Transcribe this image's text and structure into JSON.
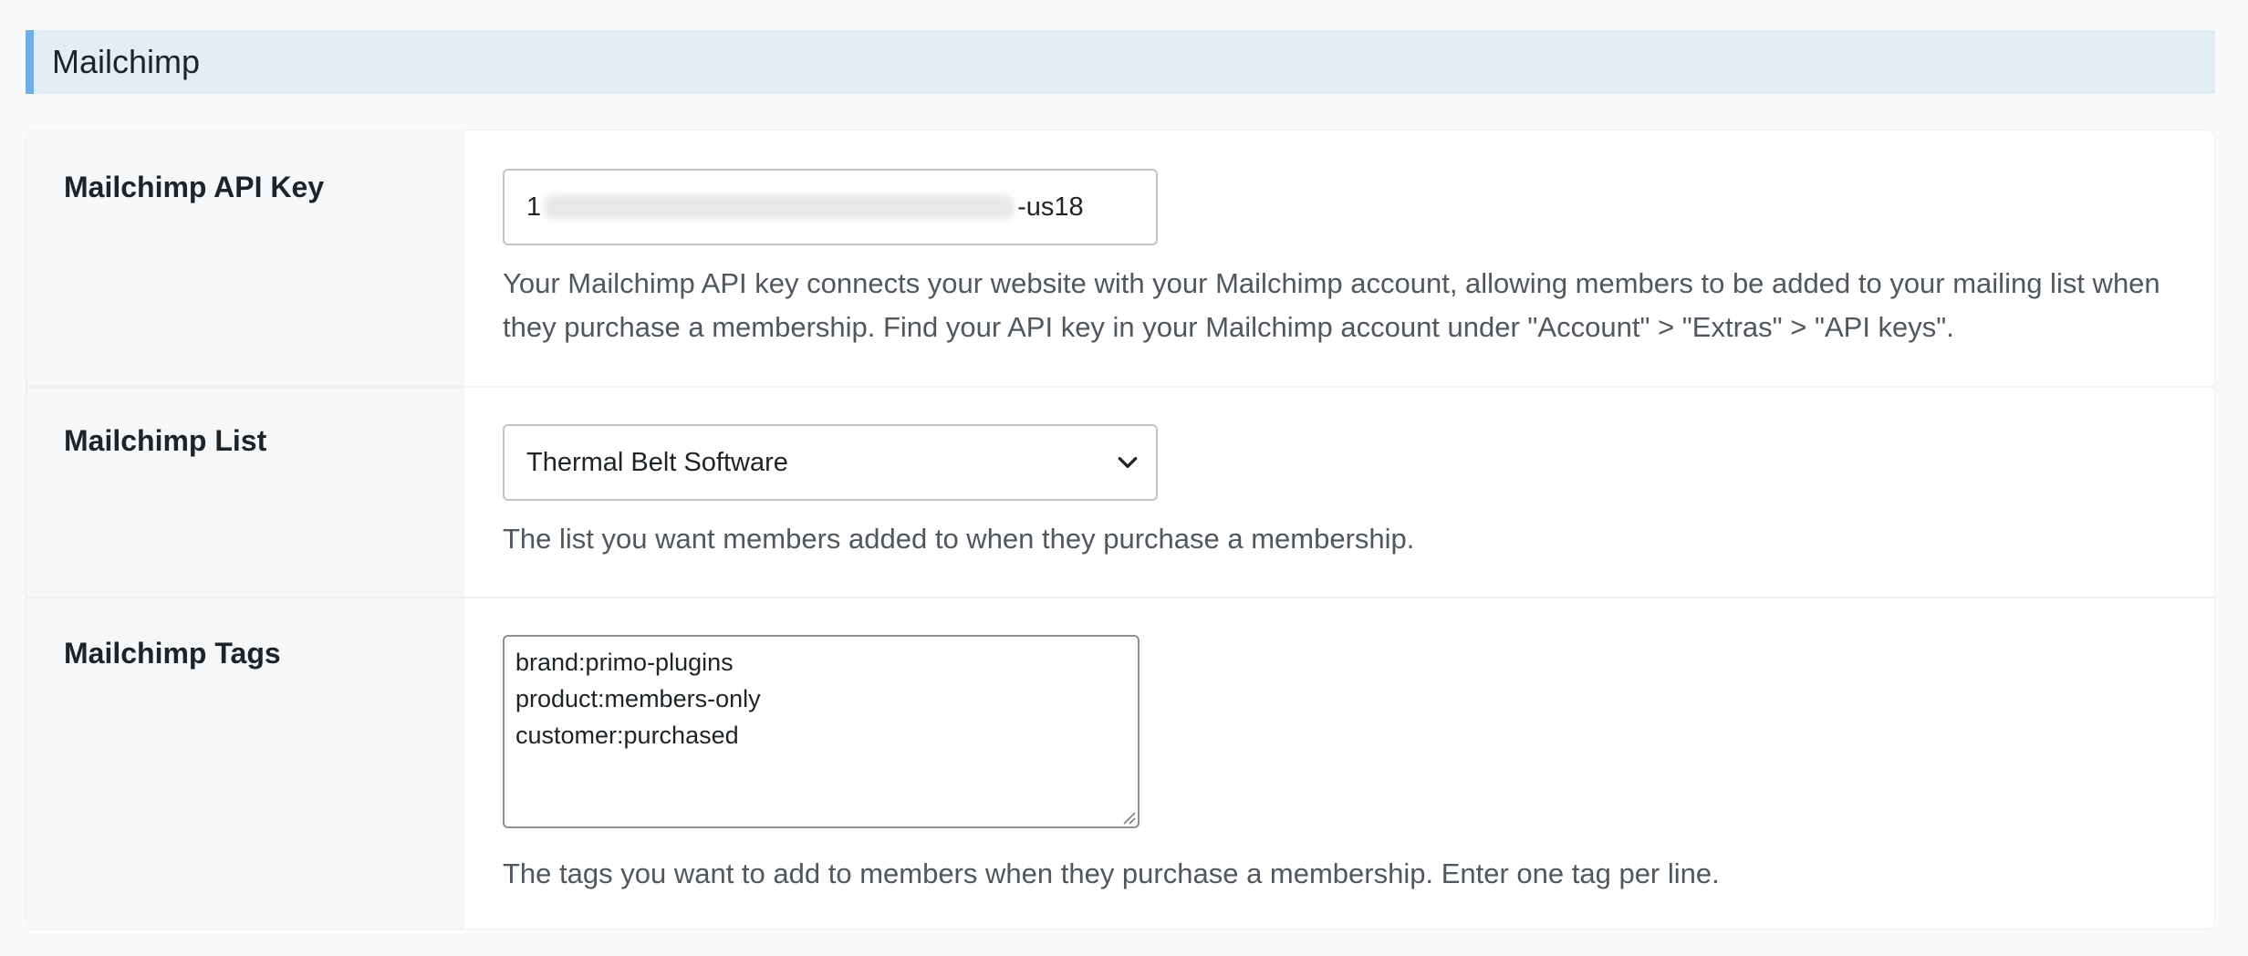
{
  "section": {
    "title": "Mailchimp"
  },
  "rows": {
    "api_key": {
      "label": "Mailchimp API Key",
      "value_prefix": "1",
      "value_suffix": "-us18",
      "description": "Your Mailchimp API key connects your website with your Mailchimp account, allowing members to be added to your mailing list when they purchase a membership. Find your API key in your Mailchimp account under \"Account\" > \"Extras\" > \"API keys\"."
    },
    "list": {
      "label": "Mailchimp List",
      "selected": "Thermal Belt Software",
      "description": "The list you want members added to when they purchase a membership."
    },
    "tags": {
      "label": "Mailchimp Tags",
      "values": [
        "brand:primo-plugins",
        "product:members-only",
        "customer:purchased"
      ],
      "description": "The tags you want to add to members when they purchase a membership. Enter one tag per line."
    }
  },
  "colors": {
    "header_background": "#e2eef3",
    "header_accent": "#72aee6",
    "label_background": "#f6f7f8",
    "description_text": "#50575e"
  },
  "icons": {
    "select_toggle": "chevron-down-icon",
    "textarea_resize": "resize-grip-icon"
  }
}
